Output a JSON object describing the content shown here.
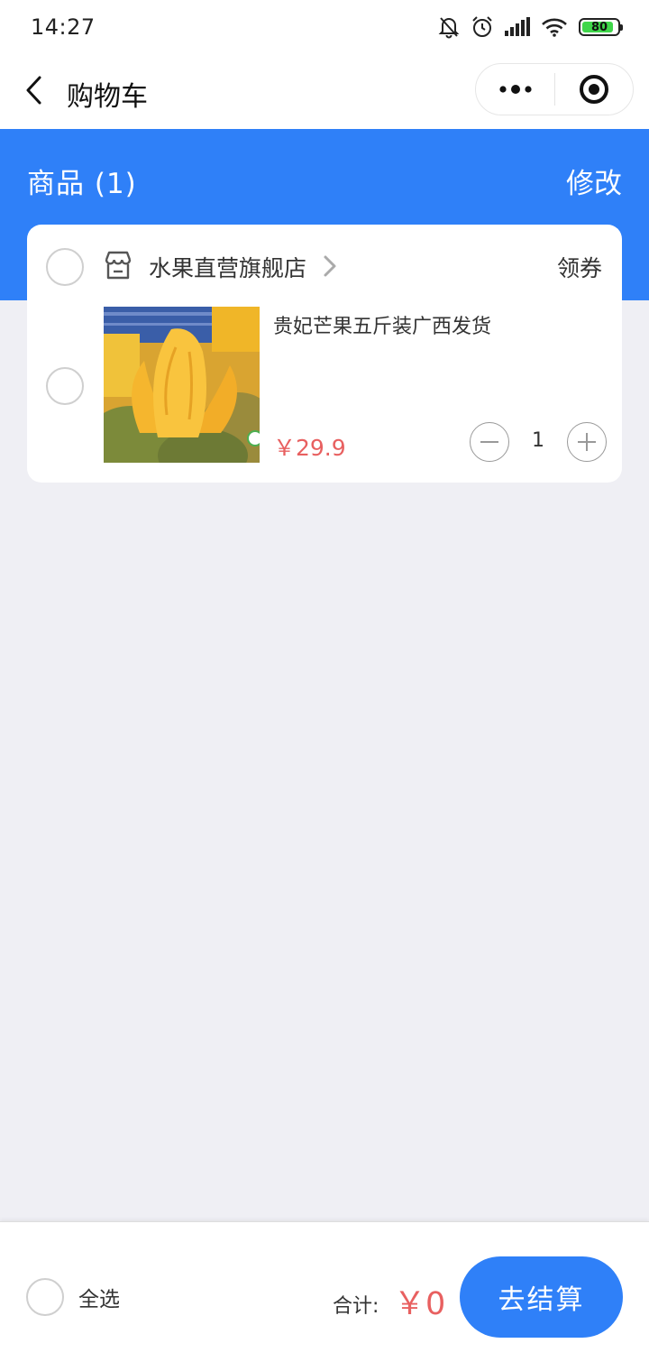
{
  "status_bar": {
    "time": "14:27",
    "battery_level": "80",
    "icons": [
      "bell-off-icon",
      "alarm-icon",
      "signal-icon",
      "wifi-icon",
      "battery-icon"
    ]
  },
  "nav": {
    "title": "购物车",
    "back_icon": "chevron-left-icon",
    "more_icon": "more-dots-icon",
    "close_icon": "target-close-icon"
  },
  "header": {
    "goods_label": "商品 (1)",
    "edit_label": "修改"
  },
  "cart": {
    "shop": {
      "name": "水果直营旗舰店",
      "coupon_label": "领券",
      "icon": "store-icon"
    },
    "items": [
      {
        "name": "贵妃芒果五斤装广西发货",
        "price": "￥29.9",
        "quantity": "1"
      }
    ]
  },
  "footer": {
    "select_all_label": "全选",
    "total_label": "合计:",
    "total_value": "￥0",
    "checkout_label": "去结算"
  },
  "colors": {
    "brand_blue": "#2f80f8",
    "price_red": "#e86060",
    "page_bg": "#efeff4"
  }
}
